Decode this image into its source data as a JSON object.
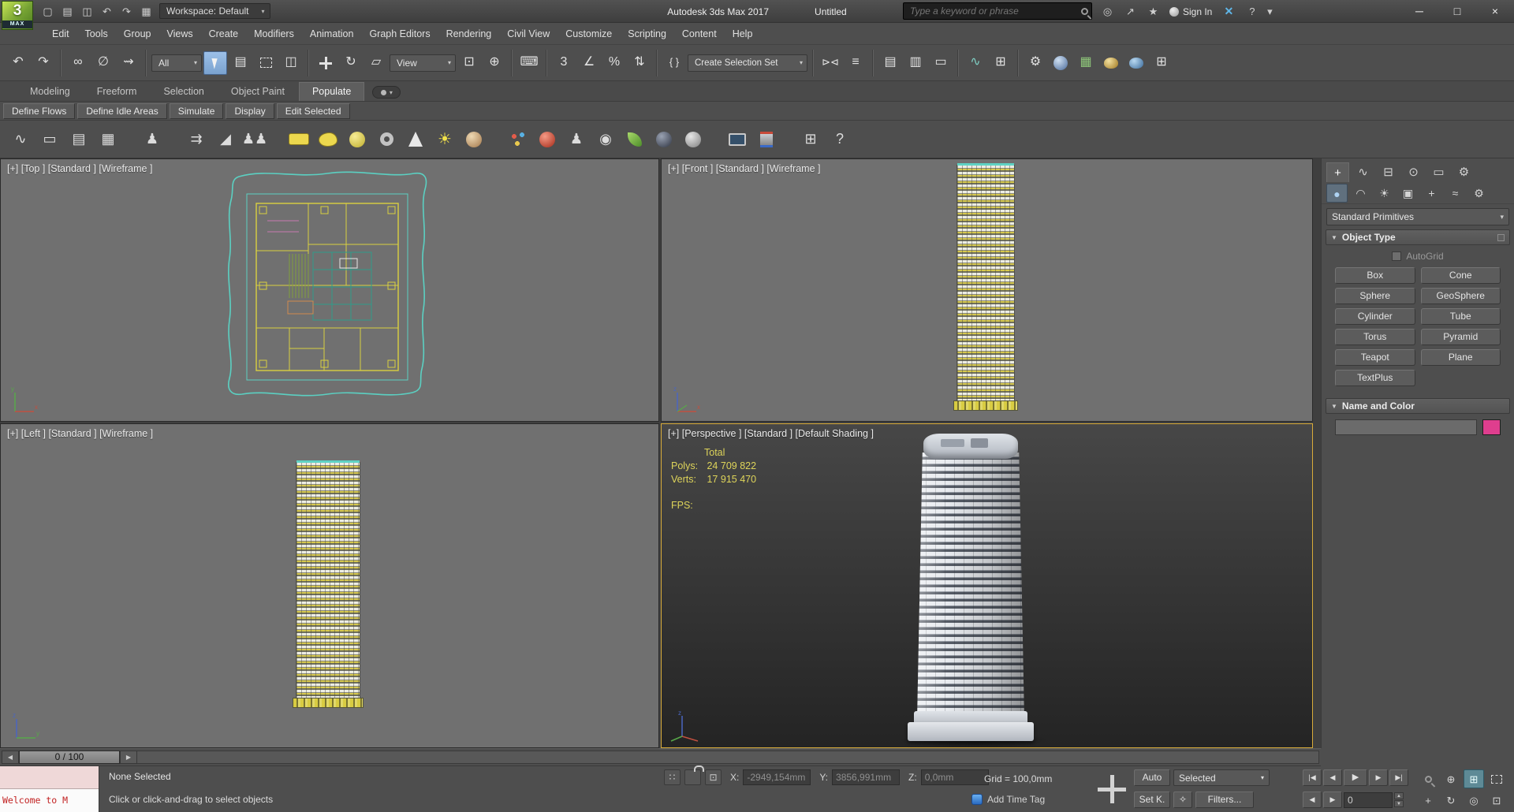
{
  "colors": {
    "accent_viewport_border": "#d9ac3a",
    "stats_text": "#ded45a",
    "name_color_swatch": "#df3e8e",
    "active_tool_blue": "#8ab4e0",
    "logo_green": "#79a838",
    "maxscript_pink": "#efd8d8"
  },
  "titlebar": {
    "logo_number": "3",
    "logo_text": "MAX",
    "icons": {
      "new": "▢",
      "open": "▤",
      "save": "◫",
      "undo": "↶",
      "redo": "↷",
      "workspace": "▦",
      "arrow": "▾"
    },
    "workspace": "Workspace: Default",
    "app_title": "Autodesk 3ds Max 2017",
    "doc_title": "Untitled",
    "search_placeholder": "Type a keyword or phrase",
    "community": {
      "a": "◎",
      "b": "↗",
      "c": "★"
    },
    "sign_in": "Sign In",
    "infocenter_x": "✕",
    "help": "?",
    "win": {
      "min": "─",
      "max": "□",
      "close": "×"
    }
  },
  "menus": [
    "Edit",
    "Tools",
    "Group",
    "Views",
    "Create",
    "Modifiers",
    "Animation",
    "Graph Editors",
    "Rendering",
    "Civil View",
    "Customize",
    "Scripting",
    "Content",
    "Help"
  ],
  "tb": {
    "undo": "↶",
    "redo": "↷",
    "link": "∞",
    "unlink": "∅",
    "bind": "⇝",
    "all": "All",
    "selname": "▤",
    "crossing": "◫",
    "rotate": "↻",
    "scale": "▱",
    "view": "View",
    "pivot": "⊡",
    "manip": "⊕",
    "kbd": "⌨",
    "snap": "3",
    "snapang": "∠",
    "snappct": "%",
    "snapspin": "⇅",
    "sets": "{ }",
    "css": "Create Selection Set",
    "mirror": "⊳⊲",
    "align": "≡",
    "layers": "▤",
    "explorer": "▥",
    "ribbon": "▭",
    "curve": "∿",
    "schematic": "⊞",
    "rsetup": "⚙",
    "rframe": "▦",
    "grid": "⊞"
  },
  "ribbon": {
    "tabs": [
      "Modeling",
      "Freeform",
      "Selection",
      "Object Paint",
      "Populate"
    ],
    "more": "▾"
  },
  "pop_tools": [
    "Define Flows",
    "Define Idle Areas",
    "Simulate",
    "Display",
    "Edit Selected"
  ],
  "picons": {
    "flow": "∿",
    "monitor": "▭",
    "sheet": "▤",
    "table": "▦",
    "person": "♟",
    "arrows": "⇉",
    "ramp": "◢",
    "pair": "♟♟",
    "sun": "☀",
    "badge": "♟",
    "swirl": "◉",
    "grid": "⊞",
    "help": "?"
  },
  "cpanel": {
    "tabs1": [
      {
        "g": "+"
      },
      {
        "g": "∿"
      },
      {
        "g": "⊟"
      },
      {
        "g": "⊙"
      },
      {
        "g": "▭"
      },
      {
        "g": "⚙"
      }
    ],
    "tabs2": [
      {
        "g": "●"
      },
      {
        "g": "◠"
      },
      {
        "g": "☀"
      },
      {
        "g": "▣"
      },
      {
        "g": "+"
      },
      {
        "g": "≈"
      },
      {
        "g": "⚙"
      }
    ],
    "category": "Standard Primitives",
    "object_type": "Object Type",
    "autogrid": "AutoGrid",
    "buttons": [
      "Box",
      "Cone",
      "Sphere",
      "GeoSphere",
      "Cylinder",
      "Tube",
      "Torus",
      "Pyramid",
      "Teapot",
      "Plane",
      "TextPlus"
    ],
    "name_color": "Name and Color",
    "arrow": "▾",
    "roll": "▼"
  },
  "viewports": {
    "top_label": "[+] [Top ] [Standard ] [Wireframe ]",
    "front_label": "[+] [Front ] [Standard ] [Wireframe ]",
    "left_label": "[+] [Left ] [Standard ] [Wireframe ]",
    "persp_label": "[+] [Perspective ] [Standard ] [Default Shading ]",
    "stats": {
      "total": "Total",
      "polys_label": "Polys:",
      "polys": "24 709 822",
      "verts_label": "Verts:",
      "verts": "17 915 470",
      "fps_label": "FPS:"
    }
  },
  "timeslider": {
    "value": "0 / 100",
    "prev": "◀",
    "next": "▶"
  },
  "statusbar": {
    "mxs": "Welcome to M",
    "none_selected": "None Selected",
    "prompt": "Click or click-and-drag to select objects",
    "dots": "∷",
    "absrel": "⊡",
    "xl": "X:",
    "yl": "Y:",
    "zl": "Z:",
    "xv": "-2949,154mm",
    "yv": "3856,991mm",
    "zv": "0,0mm",
    "grid": "Grid = 100,0mm",
    "add_time_tag": "Add Time Tag",
    "auto": "Auto",
    "selected": "Selected",
    "setk": "Set K.",
    "key": "✧",
    "filters": "Filters...",
    "frame": "0",
    "pb": {
      "start": "|◀",
      "prev": "◀",
      "play": "▶",
      "next": "▶",
      "end": "▶|",
      "fprev": "◀",
      "fnext": "▶",
      "up": "▲",
      "down": "▼"
    },
    "nav": {
      "zoomall": "⊕",
      "extents": "⊞",
      "region_label": "",
      "pan": "+",
      "orbit": "↻",
      "fov": "◎",
      "maximize": "⊡"
    }
  }
}
